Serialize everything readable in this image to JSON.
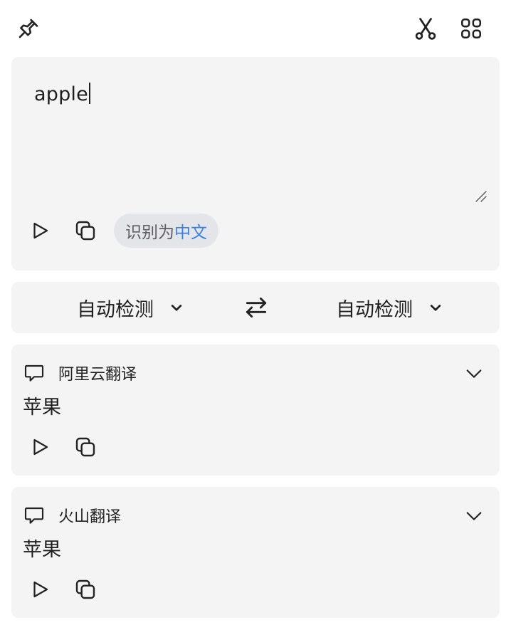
{
  "toolbar": {
    "pin_icon": "pin-icon",
    "scissors_icon": "scissors-icon",
    "apps_icon": "grid-icon"
  },
  "source": {
    "text": "apple",
    "detected_prefix": "识别为",
    "detected_language": "中文"
  },
  "languages": {
    "from": "自动检测",
    "to": "自动检测"
  },
  "results": [
    {
      "service": "阿里云翻译",
      "text": "苹果"
    },
    {
      "service": "火山翻译",
      "text": "苹果"
    }
  ],
  "colors": {
    "panel_bg": "#f4f4f4",
    "badge_bg": "#e4e5e9",
    "accent": "#3d7fe0"
  }
}
